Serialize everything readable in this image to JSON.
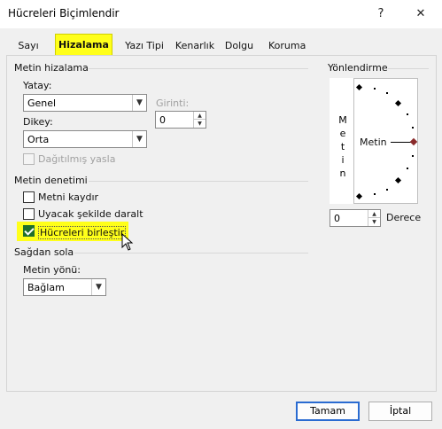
{
  "window": {
    "title": "Hücreleri Biçimlendir",
    "help": "?",
    "close": "✕"
  },
  "tabs": [
    "Sayı",
    "Hizalama",
    "Yazı Tipi",
    "Kenarlık",
    "Dolgu",
    "Koruma"
  ],
  "text_alignment": {
    "title": "Metin hizalama",
    "horizontal_label": "Yatay:",
    "horizontal_value": "Genel",
    "indent_label": "Girinti:",
    "indent_value": "0",
    "vertical_label": "Dikey:",
    "vertical_value": "Orta",
    "distributed_label": "Dağıtılmış yasla"
  },
  "text_control": {
    "title": "Metin denetimi",
    "wrap_label": "Metni kaydır",
    "shrink_label": "Uyacak şekilde daralt",
    "merge_label": "Hücreleri birleştir"
  },
  "rtl": {
    "title": "Sağdan sola",
    "direction_label": "Metin yönü:",
    "direction_value": "Bağlam"
  },
  "orientation": {
    "title": "Yönlendirme",
    "vertical_letters": [
      "M",
      "e",
      "t",
      "i",
      "n"
    ],
    "text": "Metin",
    "degree_value": "0",
    "degree_label": "Derece"
  },
  "buttons": {
    "ok": "Tamam",
    "cancel": "İptal"
  },
  "colors": {
    "highlight": "#ffff1a",
    "check": "#1f6f2c",
    "default_button_border": "#2a6bd1"
  }
}
